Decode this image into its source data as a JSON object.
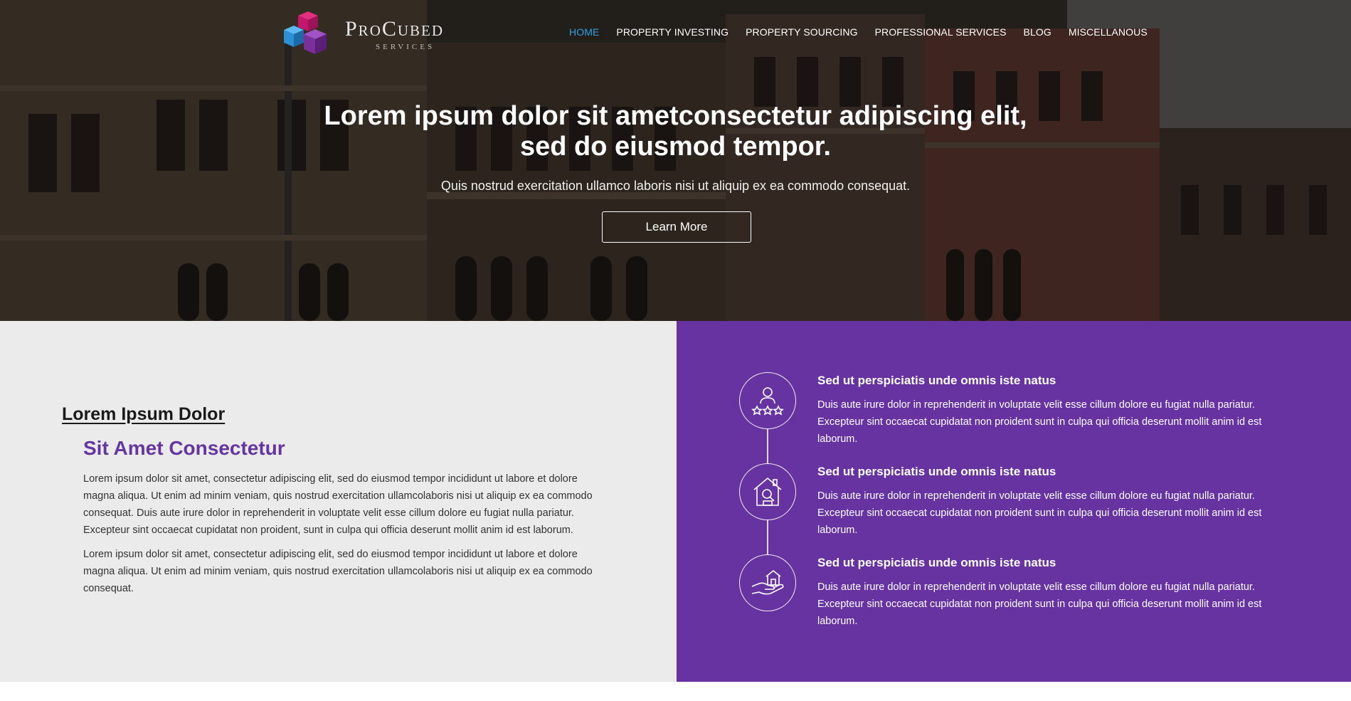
{
  "brand": {
    "name": "ProCubed",
    "sub": "SERVICES",
    "colors": {
      "cube_pink": "#c4176c",
      "cube_blue": "#2b8fd6",
      "cube_purple": "#7a2f9a"
    }
  },
  "nav": {
    "items": [
      "HOME",
      "PROPERTY INVESTING",
      "PROPERTY SOURCING",
      "PROFESSIONAL SERVICES",
      "BLOG",
      "MISCELLANOUS"
    ],
    "active": "HOME",
    "active_color": "#2fa4e7"
  },
  "hero": {
    "title_line1": "Lorem ipsum dolor sit ametconsectetur adipiscing elit,",
    "title_line2": "sed do eiusmod tempor.",
    "subtitle": "Quis nostrud exercitation ullamco laboris nisi ut aliquip ex ea commodo consequat.",
    "button_label": "Learn More"
  },
  "intro": {
    "heading": "Lorem Ipsum Dolor",
    "subheading": "Sit Amet Consectetur",
    "paragraph1": "Lorem ipsum dolor sit amet, consectetur adipiscing elit, sed do eiusmod tempor incididunt ut labore et dolore magna aliqua. Ut enim ad minim veniam, quis nostrud exercitation ullamcolaboris nisi ut aliquip ex ea commodo consequat. Duis aute irure dolor in reprehenderit in voluptate velit esse cillum dolore eu fugiat nulla pariatur. Excepteur sint occaecat cupidatat non proident, sunt in culpa qui officia deserunt mollit anim id est laborum.",
    "paragraph2": "Lorem ipsum dolor sit amet, consectetur adipiscing elit, sed do eiusmod tempor incididunt ut labore et dolore magna aliqua. Ut enim ad minim veniam, quis nostrud exercitation ullamcolaboris nisi ut aliquip ex ea commodo consequat.",
    "accent_color": "#6535a0"
  },
  "features": {
    "background": "#6733a1",
    "items": [
      {
        "icon": "user-rating-icon",
        "title": "Sed ut perspiciatis unde omnis iste natus",
        "text": "Duis aute irure dolor in reprehenderit in voluptate velit esse cillum dolore eu fugiat nulla pariatur. Excepteur sint occaecat cupidatat non proident sunt in culpa qui officia deserunt mollit anim id est laborum."
      },
      {
        "icon": "house-search-icon",
        "title": "Sed ut perspiciatis unde omnis iste natus",
        "text": "Duis aute irure dolor in reprehenderit in voluptate velit esse cillum dolore eu fugiat nulla pariatur. Excepteur sint occaecat cupidatat non proident sunt in culpa qui officia deserunt mollit anim id est laborum."
      },
      {
        "icon": "hand-house-icon",
        "title": "Sed ut perspiciatis unde omnis iste natus",
        "text": "Duis aute irure dolor in reprehenderit in voluptate velit esse cillum dolore eu fugiat nulla pariatur. Excepteur sint occaecat cupidatat non proident sunt in culpa qui officia deserunt mollit anim id est laborum."
      }
    ]
  }
}
